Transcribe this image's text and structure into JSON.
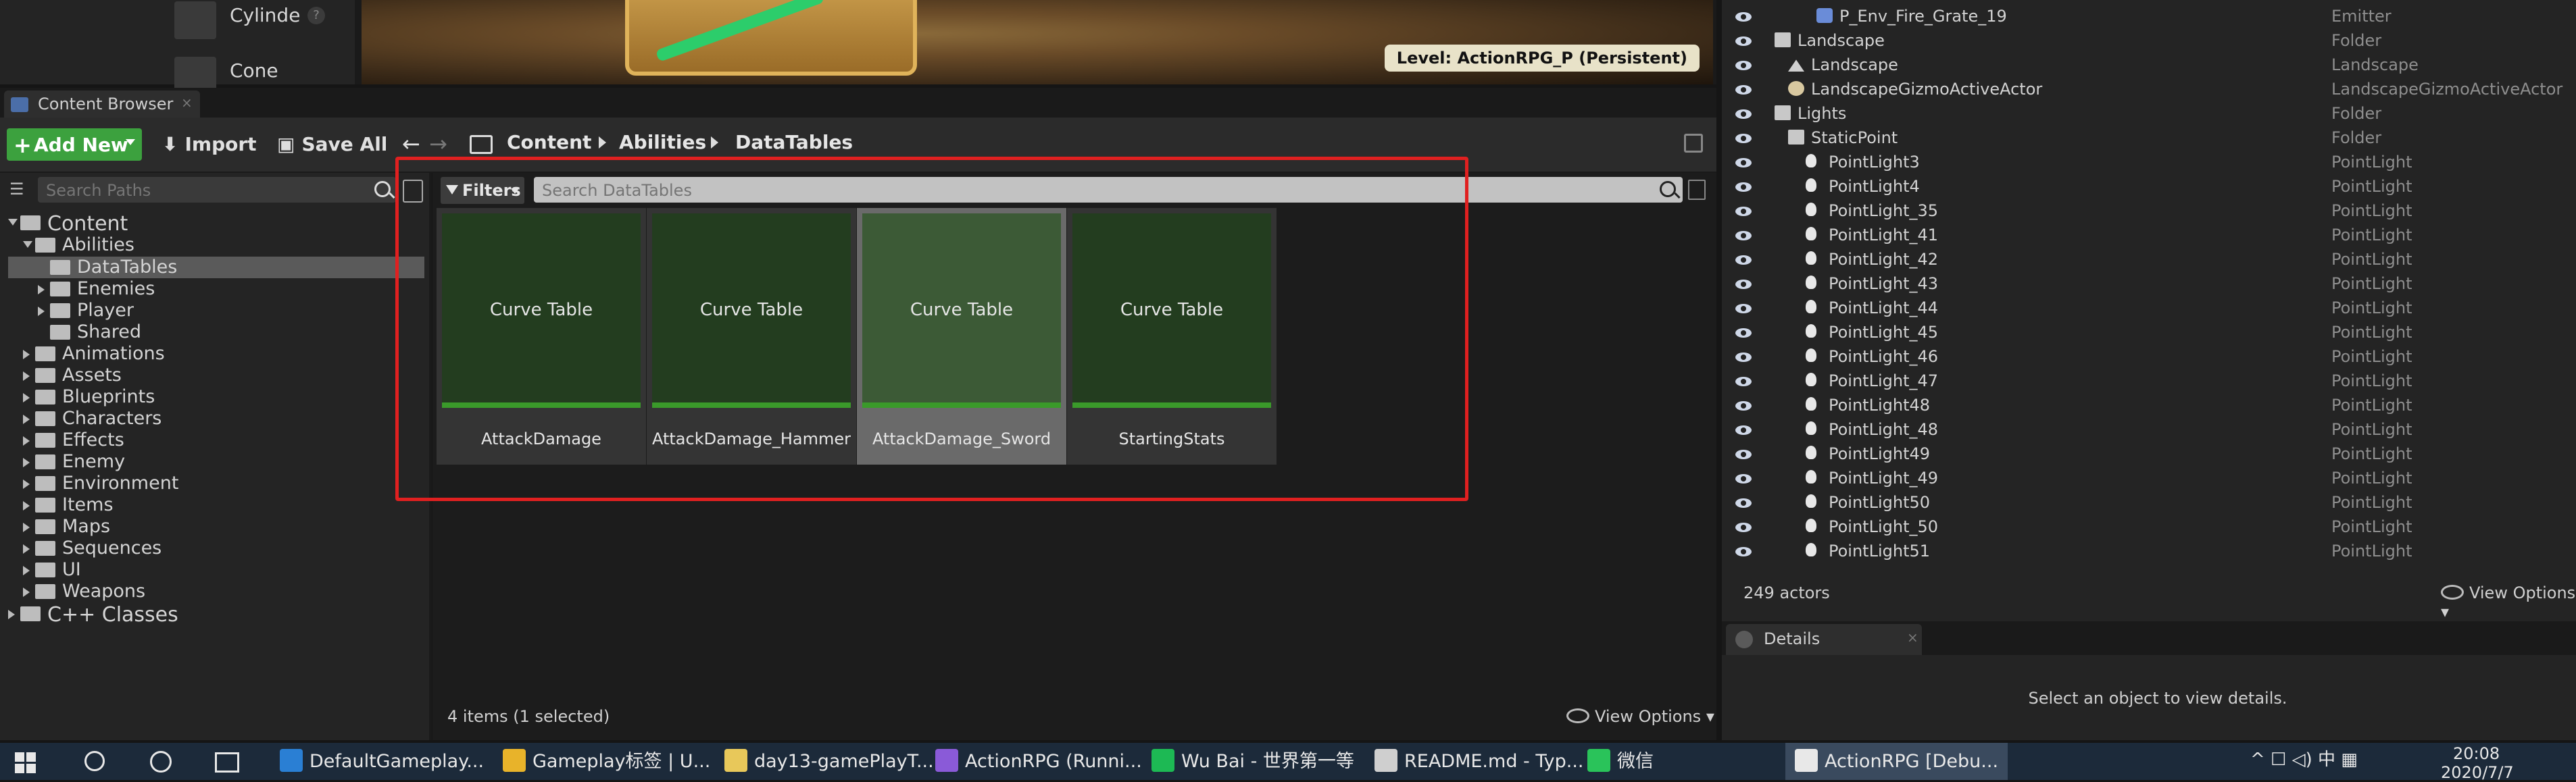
{
  "placement": {
    "items": [
      {
        "label": "Cylinde",
        "icon": "cylinder-icon"
      },
      {
        "label": "Cone",
        "icon": "cone-icon"
      }
    ],
    "help_glyph": "?"
  },
  "viewport": {
    "level_label": "Level:  ActionRPG_P (Persistent)"
  },
  "content_browser": {
    "tab_label": "Content Browser",
    "tab_close": "×",
    "toolbar": {
      "add_new_label": "Add New",
      "import_label": "Import",
      "save_all_label": "Save All"
    },
    "breadcrumbs": [
      "Content",
      "Abilities",
      "DataTables"
    ],
    "path_search_placeholder": "Search Paths",
    "asset_search_placeholder": "Search DataTables",
    "filters_label": "Filters",
    "tree": [
      {
        "label": "Content",
        "depth": 0,
        "open": true
      },
      {
        "label": "Abilities",
        "depth": 1,
        "open": true
      },
      {
        "label": "DataTables",
        "depth": 2,
        "selected": true
      },
      {
        "label": "Enemies",
        "depth": 2,
        "open": false
      },
      {
        "label": "Player",
        "depth": 2,
        "open": false
      },
      {
        "label": "Shared",
        "depth": 2
      },
      {
        "label": "Animations",
        "depth": 1,
        "open": false
      },
      {
        "label": "Assets",
        "depth": 1,
        "open": false
      },
      {
        "label": "Blueprints",
        "depth": 1,
        "open": false
      },
      {
        "label": "Characters",
        "depth": 1,
        "open": false
      },
      {
        "label": "Effects",
        "depth": 1,
        "open": false
      },
      {
        "label": "Enemy",
        "depth": 1,
        "open": false
      },
      {
        "label": "Environment",
        "depth": 1,
        "open": false
      },
      {
        "label": "Items",
        "depth": 1,
        "open": false
      },
      {
        "label": "Maps",
        "depth": 1,
        "open": false
      },
      {
        "label": "Sequences",
        "depth": 1,
        "open": false
      },
      {
        "label": "UI",
        "depth": 1,
        "open": false
      },
      {
        "label": "Weapons",
        "depth": 1,
        "open": false
      },
      {
        "label": "C++ Classes",
        "depth": 0,
        "open": false
      }
    ],
    "assets": [
      {
        "type_label": "Curve Table",
        "name": "AttackDamage",
        "selected": false
      },
      {
        "type_label": "Curve Table",
        "name": "AttackDamage_Hammer",
        "selected": false
      },
      {
        "type_label": "Curve Table",
        "name": "AttackDamage_Sword",
        "selected": true
      },
      {
        "type_label": "Curve Table",
        "name": "StartingStats",
        "selected": false
      }
    ],
    "items_count": "4 items (1 selected)",
    "view_options_label": "View Options"
  },
  "outliner": {
    "rows": [
      {
        "name": "P_Env_Fire_Grate_19",
        "type": "Emitter",
        "icon": "emitter-icon"
      },
      {
        "name": "Landscape",
        "type": "Folder",
        "icon": "folder-icon"
      },
      {
        "name": "Landscape",
        "type": "Landscape",
        "icon": "landscape-icon"
      },
      {
        "name": "LandscapeGizmoActiveActor",
        "type": "LandscapeGizmoActiveActor",
        "icon": "gizmo-icon"
      },
      {
        "name": "Lights",
        "type": "Folder",
        "icon": "folder-icon"
      },
      {
        "name": "StaticPoint",
        "type": "Folder",
        "icon": "folder-icon"
      },
      {
        "name": "PointLight3",
        "type": "PointLight",
        "icon": "pointlight-icon"
      },
      {
        "name": "PointLight4",
        "type": "PointLight",
        "icon": "pointlight-icon"
      },
      {
        "name": "PointLight_35",
        "type": "PointLight",
        "icon": "pointlight-icon"
      },
      {
        "name": "PointLight_41",
        "type": "PointLight",
        "icon": "pointlight-icon"
      },
      {
        "name": "PointLight_42",
        "type": "PointLight",
        "icon": "pointlight-icon"
      },
      {
        "name": "PointLight_43",
        "type": "PointLight",
        "icon": "pointlight-icon"
      },
      {
        "name": "PointLight_44",
        "type": "PointLight",
        "icon": "pointlight-icon"
      },
      {
        "name": "PointLight_45",
        "type": "PointLight",
        "icon": "pointlight-icon"
      },
      {
        "name": "PointLight_46",
        "type": "PointLight",
        "icon": "pointlight-icon"
      },
      {
        "name": "PointLight_47",
        "type": "PointLight",
        "icon": "pointlight-icon"
      },
      {
        "name": "PointLight48",
        "type": "PointLight",
        "icon": "pointlight-icon"
      },
      {
        "name": "PointLight_48",
        "type": "PointLight",
        "icon": "pointlight-icon"
      },
      {
        "name": "PointLight49",
        "type": "PointLight",
        "icon": "pointlight-icon"
      },
      {
        "name": "PointLight_49",
        "type": "PointLight",
        "icon": "pointlight-icon"
      },
      {
        "name": "PointLight50",
        "type": "PointLight",
        "icon": "pointlight-icon"
      },
      {
        "name": "PointLight_50",
        "type": "PointLight",
        "icon": "pointlight-icon"
      },
      {
        "name": "PointLight51",
        "type": "PointLight",
        "icon": "pointlight-icon"
      }
    ],
    "actors_count": "249 actors",
    "view_options_label": "View Options"
  },
  "details": {
    "tab_label": "Details",
    "tab_close": "×",
    "empty_message": "Select an object to view details."
  },
  "taskbar": {
    "items": [
      {
        "label": "DefaultGameplay...",
        "icon": "vscode-icon",
        "color": "#2a7fd4"
      },
      {
        "label": "Gameplay标签 | U...",
        "icon": "chrome-icon",
        "color": "#e8b32a"
      },
      {
        "label": "day13-gamePlayT...",
        "icon": "file-icon",
        "color": "#e8c85a"
      },
      {
        "label": "ActionRPG (Runni...",
        "icon": "visualstudio-icon",
        "color": "#8a5ad8"
      },
      {
        "label": "Wu Bai - 世界第一等",
        "icon": "spotify-icon",
        "color": "#1db954"
      },
      {
        "label": "README.md - Typ...",
        "icon": "typora-icon",
        "color": "#cfcfcf"
      },
      {
        "label": "微信",
        "icon": "wechat-icon",
        "color": "#2ac35a"
      },
      {
        "label": "ActionRPG [Debu...",
        "icon": "unreal-icon",
        "color": "#e8e8e8",
        "active": true
      }
    ],
    "tray_text": "^  ☐  ◁)  中  ▦",
    "clock_time": "20:08",
    "clock_date": "2020/7/7"
  }
}
